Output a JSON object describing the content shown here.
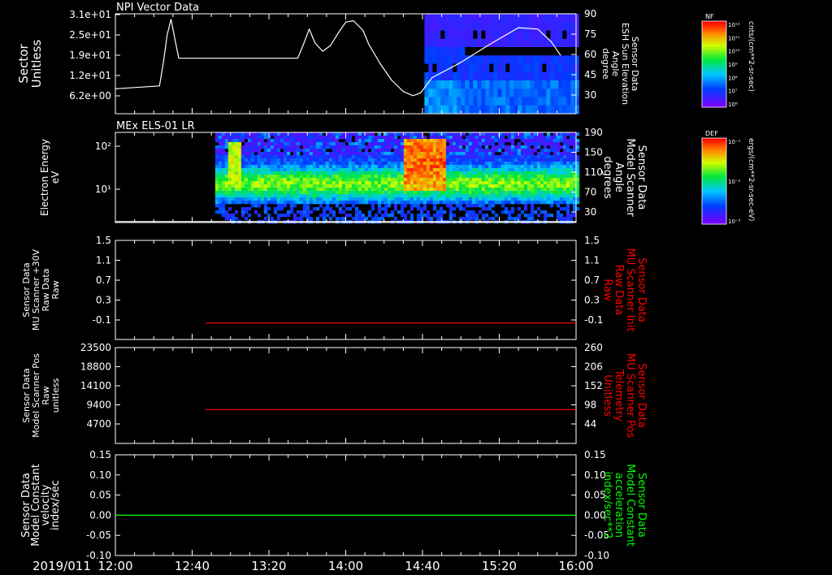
{
  "figure": {
    "date_label": "2019/011",
    "time_ticks": [
      "12:00",
      "12:40",
      "13:20",
      "14:00",
      "14:40",
      "15:20",
      "16:00"
    ],
    "background": "#000000"
  },
  "colorbars": [
    {
      "title": "NF",
      "unit": "cnts/(cm**2-sr-sec)",
      "tick_labels": [
        "10¹²",
        "10¹¹",
        "10¹⁰",
        "10⁹",
        "10⁸",
        "10⁷",
        "10⁶"
      ]
    },
    {
      "title": "DEF",
      "unit": "ergs/(cm**2-sr-sec-eV)",
      "tick_labels": [
        "10⁻¹",
        "10⁻²",
        "10⁻³"
      ]
    }
  ],
  "chart_data": [
    {
      "type": "line",
      "title": "NPI Vector Data",
      "ylabel_left": [
        "Sector",
        "Unitless"
      ],
      "yticks_left": [
        "3.1e+01",
        "2.5e+01",
        "1.9e+01",
        "1.2e+01",
        "6.2e+00"
      ],
      "ylabel_right": [
        "Sensor Data",
        "ESH Sun Elevation",
        "Angle",
        "degree"
      ],
      "yticks_right": [
        "90",
        "75",
        "60",
        "45",
        "30"
      ],
      "ylim_right": [
        18,
        90
      ],
      "spectrogram": {
        "x_start": "14:41",
        "x_end": "16:00",
        "colorbar": "NF"
      },
      "series": [
        {
          "color": "#ffffff",
          "axis": "right",
          "x": [
            "12:00",
            "12:23",
            "12:25",
            "12:27",
            "12:29",
            "12:31",
            "12:33",
            "13:35",
            "13:38",
            "13:41",
            "13:44",
            "13:48",
            "13:52",
            "13:56",
            "14:00",
            "14:04",
            "14:09",
            "14:12",
            "14:18",
            "14:24",
            "14:30",
            "14:35",
            "14:39",
            "14:45",
            "15:00",
            "15:15",
            "15:30",
            "15:40",
            "15:47",
            "15:52"
          ],
          "y": [
            36,
            38,
            55,
            75,
            86,
            72,
            58,
            58,
            68,
            79,
            69,
            63,
            67,
            76,
            84,
            85,
            78,
            68,
            54,
            42,
            34,
            31,
            33,
            44,
            55,
            68,
            80,
            79,
            70,
            60
          ]
        }
      ]
    },
    {
      "type": "heatmap",
      "title": "MEx ELS-01 LR",
      "ylabel_left": [
        "Electron Energy",
        "eV"
      ],
      "yticks_left": [
        "10²",
        "10¹"
      ],
      "ylabel_right": [
        "Sensor Data",
        "Model Scanner",
        "Angle",
        "degrees"
      ],
      "yticks_right": [
        "190",
        "150",
        "110",
        "70",
        "30"
      ],
      "ylim_right": [
        0,
        190
      ],
      "data_start": "12:52",
      "colorbar": "DEF",
      "series": [
        {
          "color": "#ffffff",
          "axis": "right",
          "x": [
            "12:00",
            "16:00"
          ],
          "y": [
            2,
            2
          ]
        }
      ]
    },
    {
      "type": "line",
      "ylabel_left": [
        "Sensor Data",
        "MU Scanner +30V",
        "Raw Data",
        "Raw"
      ],
      "yticks_left": [
        "1.5",
        "1.1",
        "0.7",
        "0.3",
        "-0.1"
      ],
      "ylim": [
        -0.3,
        1.5
      ],
      "ylabel_right": [
        "Sensor Data",
        "MU Scanner Init",
        "Raw Data",
        "Raw"
      ],
      "ylabel_right_color": "#ff0000",
      "yticks_right": [
        "1.5",
        "1.1",
        "0.7",
        "0.3",
        "-0.1"
      ],
      "series": [
        {
          "color": "#ff0000",
          "x": [
            "12:47",
            "16:00"
          ],
          "y": [
            0.0,
            0.0
          ]
        }
      ]
    },
    {
      "type": "line",
      "ylabel_left": [
        "Sensor Data",
        "Model Scanner Pos",
        "Raw",
        "unitless"
      ],
      "yticks_left": [
        "23500",
        "18800",
        "14100",
        "9400",
        "4700"
      ],
      "ylim": [
        0,
        23500
      ],
      "ylabel_right": [
        "Sensor Data",
        "MU Scanner Pos",
        "Telemetry",
        "Unitless"
      ],
      "ylabel_right_color": "#ff0000",
      "yticks_right": [
        "260",
        "206",
        "152",
        "98",
        "44"
      ],
      "series": [
        {
          "color": "#ff0000",
          "x": [
            "12:47",
            "16:00"
          ],
          "y": [
            8300,
            8300
          ]
        }
      ]
    },
    {
      "type": "line",
      "ylabel_left": [
        "Sensor Data",
        "Model Constant",
        "velocity",
        "index/sec"
      ],
      "yticks_left": [
        "0.15",
        "0.10",
        "0.05",
        "0.00",
        "-0.05",
        "-0.10"
      ],
      "ylim": [
        -0.1,
        0.15
      ],
      "ylabel_right": [
        "Sensor Data",
        "Model Constant",
        "acceleration",
        "index/sec**2"
      ],
      "ylabel_right_color": "#00ff00",
      "yticks_right": [
        "0.15",
        "0.10",
        "0.05",
        "0.00",
        "-0.05",
        "-0.10"
      ],
      "series": [
        {
          "color": "#00ff00",
          "x": [
            "12:00",
            "16:00"
          ],
          "y": [
            0.0,
            0.0
          ]
        }
      ]
    }
  ]
}
